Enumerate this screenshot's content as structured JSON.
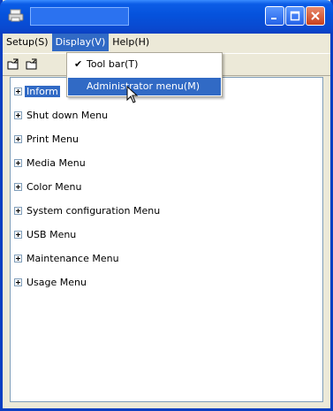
{
  "window": {
    "title": ""
  },
  "menubar": {
    "items": [
      {
        "label": "Setup(S)"
      },
      {
        "label": "Display(V)"
      },
      {
        "label": "Help(H)"
      }
    ]
  },
  "display_menu": {
    "items": [
      {
        "label": "Tool bar(T)",
        "checked": true
      },
      {
        "label": "Administrator menu(M)",
        "highlighted": true
      }
    ]
  },
  "tree": {
    "items": [
      {
        "label": "Information Menu",
        "visible_label": "Inform"
      },
      {
        "label": "Shut down Menu"
      },
      {
        "label": "Print Menu"
      },
      {
        "label": "Media Menu"
      },
      {
        "label": "Color Menu"
      },
      {
        "label": "System configuration Menu"
      },
      {
        "label": "USB Menu"
      },
      {
        "label": "Maintenance Menu"
      },
      {
        "label": "Usage Menu"
      }
    ]
  },
  "icons": {
    "app": "printer-icon",
    "toolbar": [
      "open-settings-icon",
      "save-settings-icon"
    ]
  },
  "colors": {
    "titlebar": "#0552dc",
    "highlight": "#316ac5",
    "close_button": "#c8401d"
  }
}
